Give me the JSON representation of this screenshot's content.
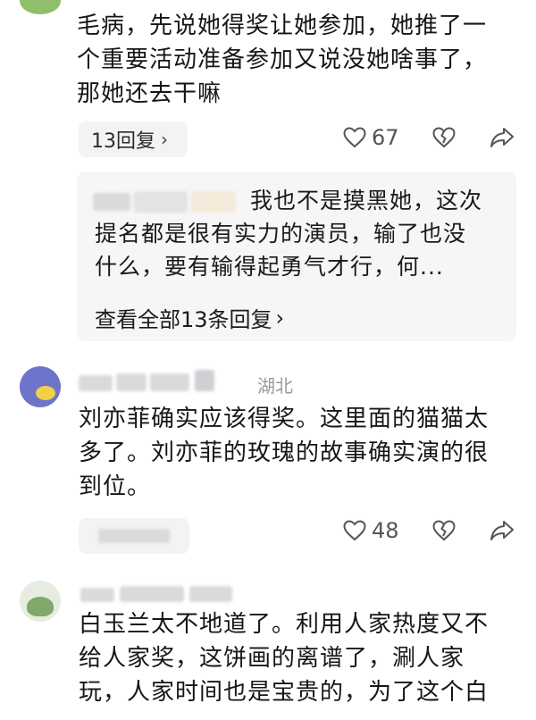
{
  "comments": [
    {
      "text_lines": [
        "毛病，先说她得奖让她参加，她推了一",
        "个重要活动准备参加又说没她啥事了，",
        "那她还去干嘛"
      ],
      "replies_label": "13回复",
      "like_count": "67",
      "reply_preview": {
        "lines": [
          "我也不是摸黑她，这次",
          "提名都是很有实力的演员，输了也没",
          "什么，要有输得起勇气才行，何..."
        ],
        "view_all_label": "查看全部13条回复"
      }
    },
    {
      "location": "湖北",
      "text_lines": [
        "刘亦菲确实应该得奖。这里面的猫猫太",
        "多了。刘亦菲的玫瑰的故事确实演的很",
        "到位。"
      ],
      "like_count": "48"
    },
    {
      "text_lines": [
        "白玉兰太不地道了。利用人家热度又不",
        "给人家奖，这饼画的离谱了，涮人家",
        "玩，人家时间也是宝贵的，为了这个白"
      ]
    }
  ],
  "icons": {
    "like": "heart-outline-icon",
    "dislike": "broken-heart-icon",
    "share": "share-arrow-icon",
    "chevron": "chevron-right-icon"
  }
}
